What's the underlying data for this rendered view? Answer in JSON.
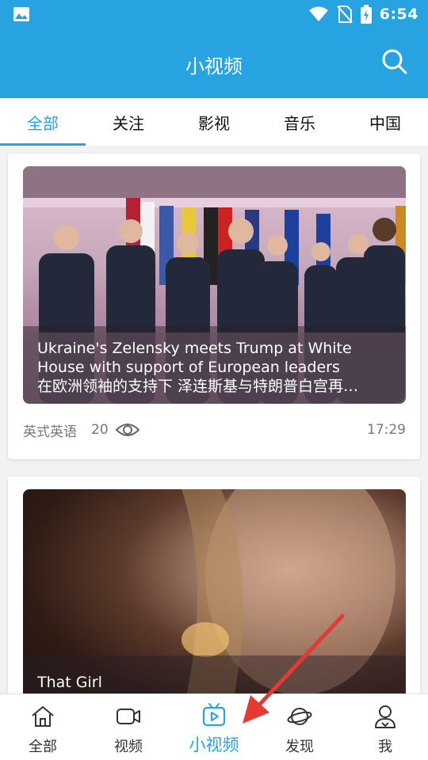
{
  "status_bar": {
    "time": "6:54"
  },
  "app_bar": {
    "title": "小视频"
  },
  "tabs": [
    {
      "label": "全部",
      "active": true
    },
    {
      "label": "关注",
      "active": false
    },
    {
      "label": "影视",
      "active": false
    },
    {
      "label": "音乐",
      "active": false
    },
    {
      "label": "中国",
      "active": false
    }
  ],
  "cards": [
    {
      "caption_en_line1": "Ukraine's Zelensky meets Trump at White",
      "caption_en_line2": "House with support of European leaders",
      "caption_zh": "在欧洲领袖的支持下 泽连斯基与特朗普白宫再…",
      "source": "英式英语",
      "views": "20",
      "duration": "17:29"
    },
    {
      "caption_en_line1": "That Girl"
    }
  ],
  "bottom_nav": [
    {
      "label": "全部",
      "icon": "home-icon"
    },
    {
      "label": "视频",
      "icon": "video-camera-icon"
    },
    {
      "label": "小视频",
      "icon": "tv-play-icon",
      "active": true
    },
    {
      "label": "发现",
      "icon": "planet-icon"
    },
    {
      "label": "我",
      "icon": "user-icon"
    }
  ],
  "colors": {
    "accent": "#27a3e1",
    "annotation_arrow": "#e53935"
  }
}
